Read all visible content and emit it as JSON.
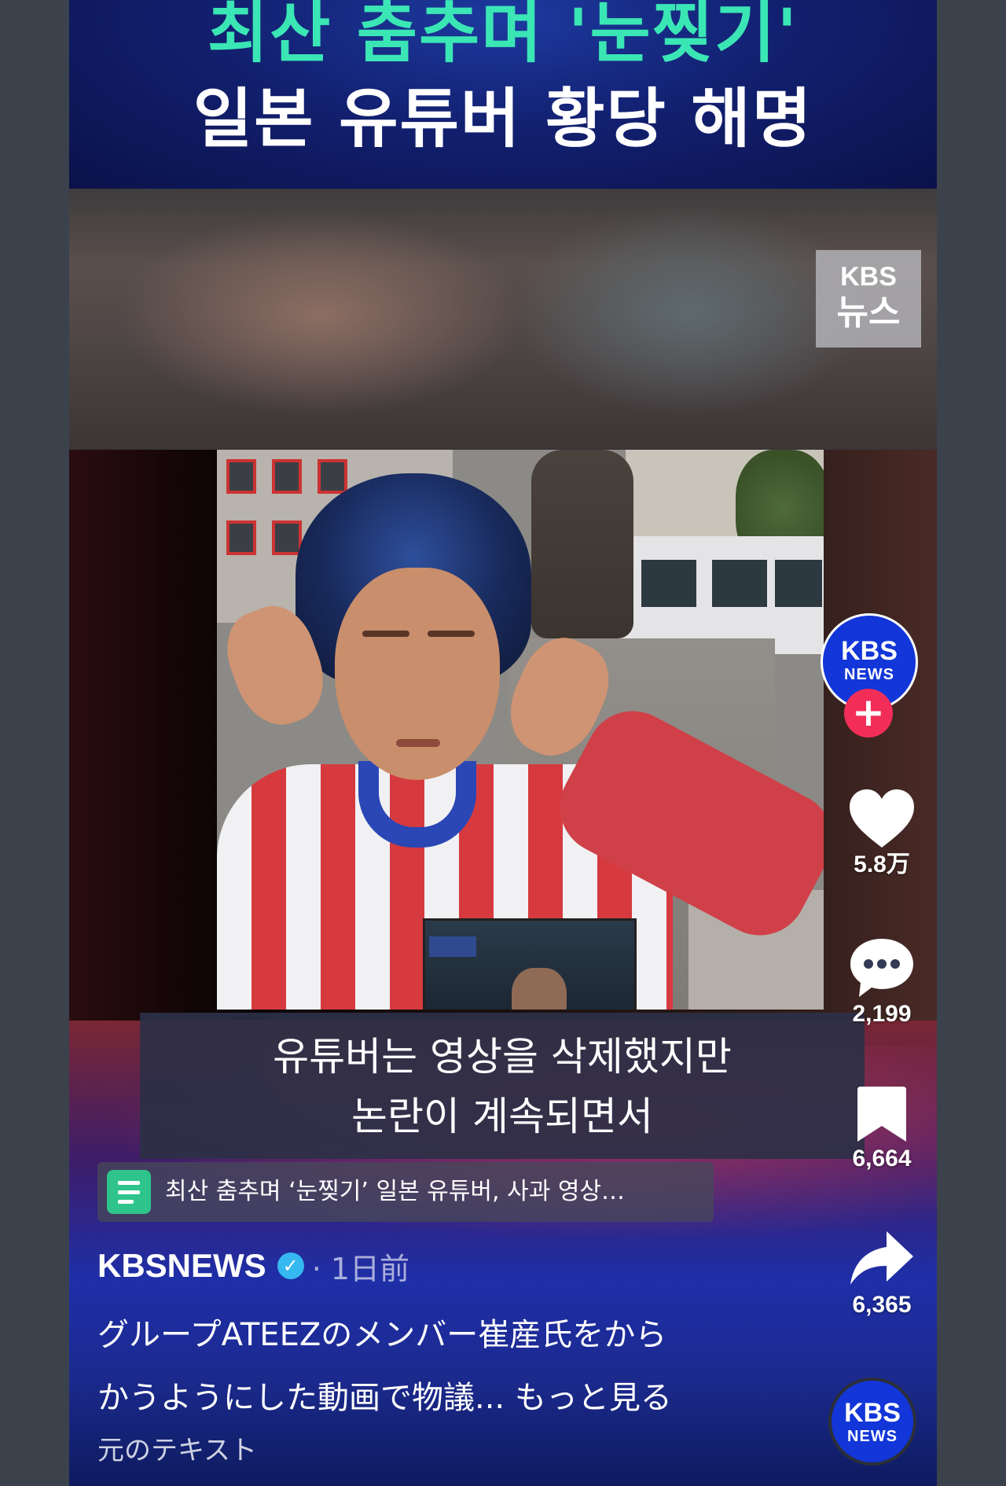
{
  "headline": {
    "line1": "최산 춤추며 '눈찢기'",
    "line2": "일본 유튜버 황당 해명"
  },
  "watermark": {
    "brand": "KBS",
    "sub": "뉴스"
  },
  "subtitle": {
    "line1": "유튜버는 영상을 삭제했지만",
    "line2": "논란이 계속되면서"
  },
  "article_link": {
    "icon": "article-icon",
    "text": "최산 춤추며 ‘눈찢기’ 일본 유튜버, 사과 영상…"
  },
  "post": {
    "author": "KBSNEWS",
    "verified_icon": "verified-badge-icon",
    "time": "· 1日前",
    "caption_line1": "グループATEEZのメンバー崔産氏をから",
    "caption_line2": "かうようにした動画で物議...",
    "more_label": "もっと見る",
    "translate_label": "元のテキスト"
  },
  "actions": {
    "avatar_logo": "KBS",
    "avatar_logo_sub": "NEWS",
    "follow_icon": "plus-icon",
    "like_count": "5.8万",
    "comment_count": "2,199",
    "bookmark_count": "6,664",
    "share_count": "6,365"
  },
  "colors": {
    "headline_accent": "#3be6b5",
    "follow_button": "#f22e58",
    "verified": "#36b8f0",
    "brand_blue": "#1236d8"
  }
}
